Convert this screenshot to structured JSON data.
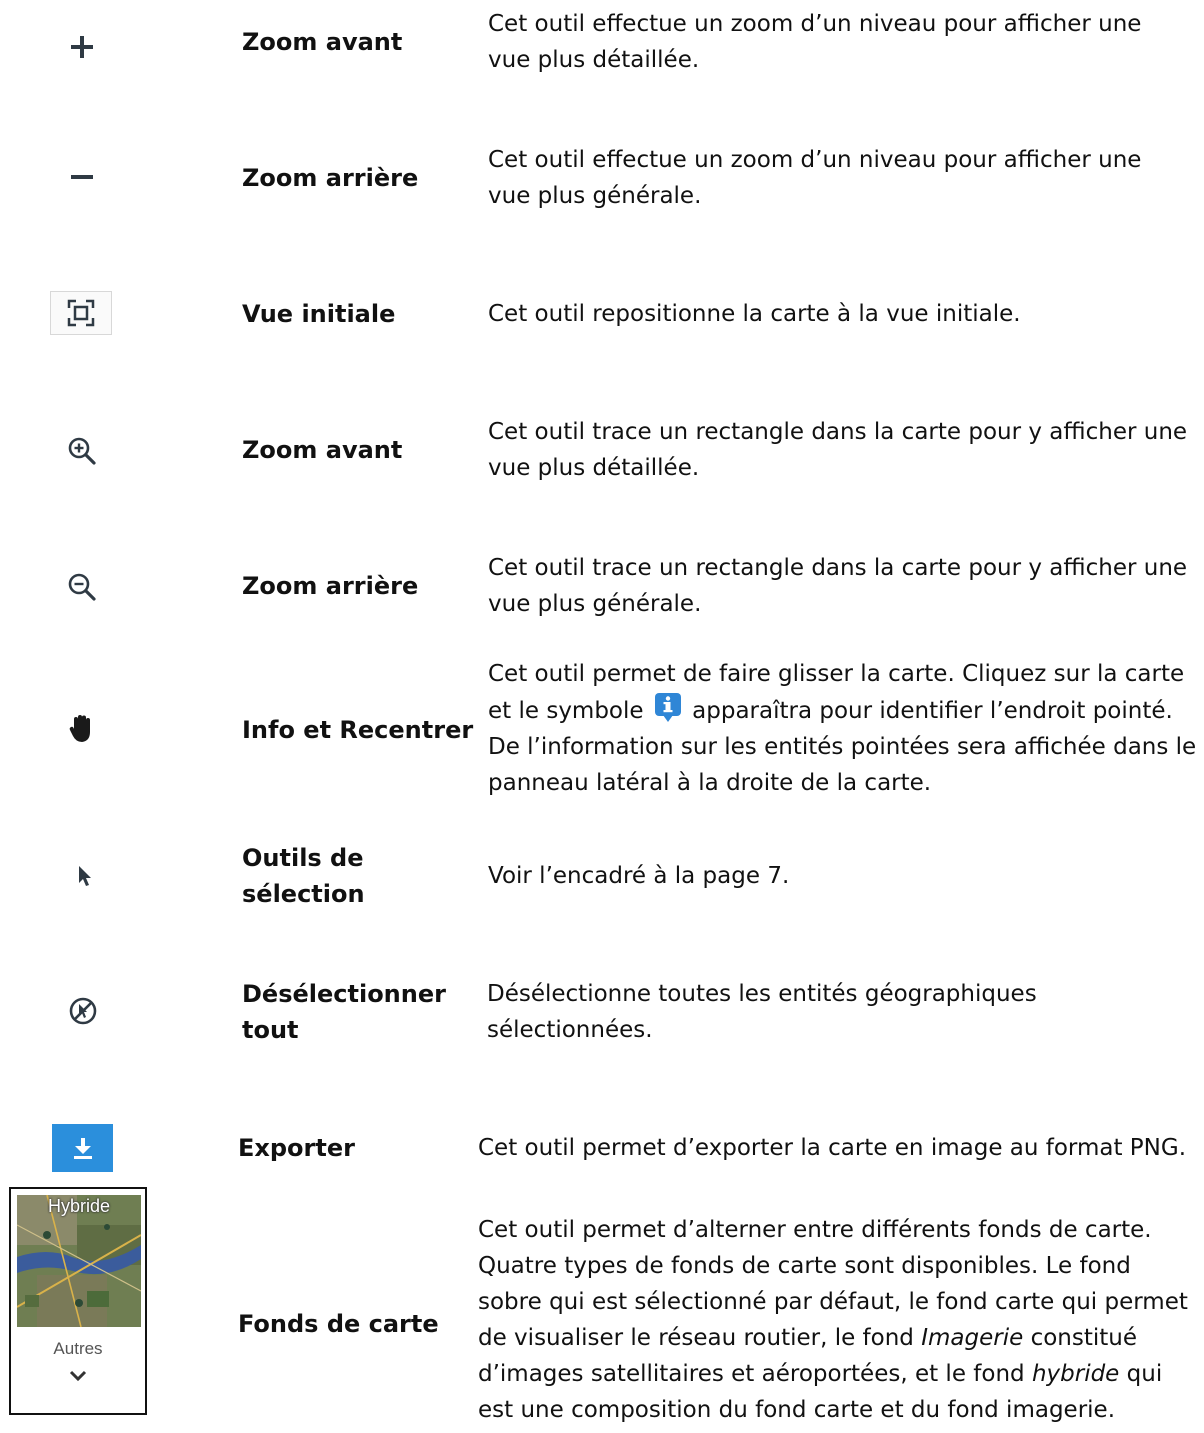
{
  "tools": [
    {
      "icon": "plus-icon",
      "name": "Zoom avant",
      "desc": "Cet outil effectue un zoom d’un niveau pour afficher une vue plus détaillée."
    },
    {
      "icon": "minus-icon",
      "name": "Zoom arrière",
      "desc": "Cet outil effectue un zoom d’un niveau pour afficher une vue plus générale."
    },
    {
      "icon": "initial-view-icon",
      "name": "Vue initiale",
      "desc": "Cet outil repositionne la carte à la vue initiale."
    },
    {
      "icon": "zoom-in-magnifier-icon",
      "name": "Zoom avant",
      "desc": "Cet outil trace un rectangle dans la carte pour y afficher une vue plus détaillée."
    },
    {
      "icon": "zoom-out-magnifier-icon",
      "name": "Zoom arrière",
      "desc": "Cet outil trace un rectangle dans la carte pour y afficher une vue plus générale."
    },
    {
      "icon": "hand-pan-icon",
      "name": "Info et Recentrer",
      "desc_part1": "Cet outil permet de faire glisser la carte. Cliquez sur la carte et le symbole",
      "desc_part2": "apparaîtra pour identifier l’endroit pointé. De l’information sur les entités pointées sera affichée dans le panneau latéral à la droite de la carte."
    },
    {
      "icon": "cursor-arrow-icon",
      "name": "Outils de sélection",
      "desc": "Voir l’encadré à la page 7."
    },
    {
      "icon": "deselect-icon",
      "name": "Désélectionner tout",
      "desc": "Désélectionne toutes les entités géographiques sélectionnées."
    },
    {
      "icon": "download-icon",
      "name": "Exporter",
      "desc": "Cet outil permet d’exporter la carte en image au format PNG."
    },
    {
      "icon": "basemap-thumbnail",
      "name": "Fonds de carte",
      "desc_a": "Cet outil permet d’alterner entre différents fonds de carte. Quatre types de fonds de carte sont disponibles. Le fond sobre qui est sélectionné par défaut, le fond carte qui permet de visualiser le réseau routier, le fond",
      "desc_b": "Imagerie",
      "desc_c": "constitué d’images satellitaires et aéroportées, et le fond",
      "desc_d": "hybride",
      "desc_e": "qui est une composition du fond carte et du fond imagerie."
    }
  ],
  "basemap_widget": {
    "thumbnail_label": "Hybride",
    "more_label": "Autres"
  },
  "colors": {
    "icon_dark": "#2f3a44",
    "export_blue": "#2b8fdc",
    "info_blue": "#2f86d6"
  }
}
